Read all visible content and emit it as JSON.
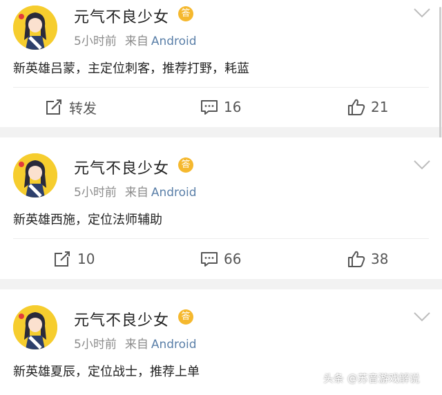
{
  "posts": [
    {
      "author": "元气不良少女",
      "badge": "答",
      "time": "5小时前",
      "from": "来自",
      "device": "Android",
      "text": "新英雄吕蒙，主定位刺客，推荐打野，耗蓝",
      "repost_label": "转发",
      "comments": "16",
      "likes": "21"
    },
    {
      "author": "元气不良少女",
      "badge": "答",
      "time": "5小时前",
      "from": "来自",
      "device": "Android",
      "text": "新英雄西施，定位法师辅助",
      "repost_label": "10",
      "comments": "66",
      "likes": "38"
    },
    {
      "author": "元气不良少女",
      "badge": "答",
      "time": "5小时前",
      "from": "来自",
      "device": "Android",
      "text": "新英雄夏辰，定位战士，推荐上单"
    }
  ],
  "watermark": "头条 @苏音游戏解说",
  "icons": {
    "repost": "repost-icon",
    "comment": "comment-icon",
    "like": "like-icon",
    "menu": "chevron-down-icon",
    "avatar": "avatar-image"
  },
  "colors": {
    "avatar_bg": "#f6cd2e",
    "badge": "#f5b82e",
    "device_link": "#5a7fa8"
  }
}
